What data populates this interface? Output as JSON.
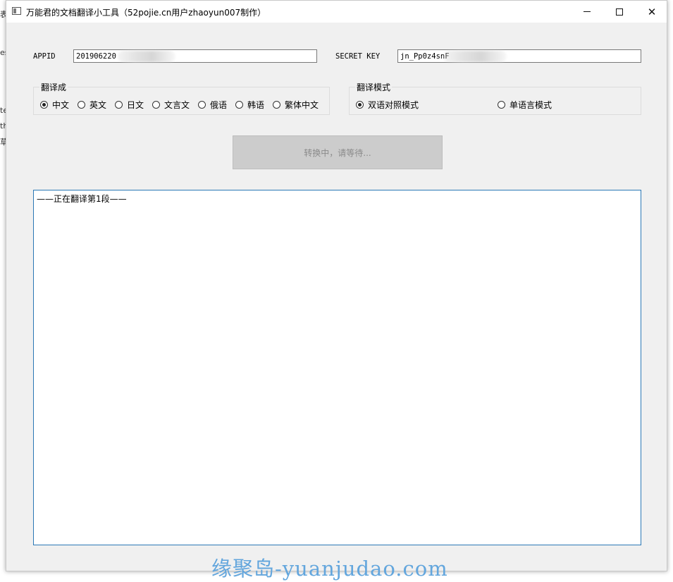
{
  "window": {
    "title": "万能君的文档翻译小工具（52pojie.cn用户zhaoyun007制作）",
    "min_glyph": "",
    "max_glyph": "",
    "close_glyph": "✕"
  },
  "credentials": {
    "appid_label": "APPID",
    "appid_value": "201906220",
    "secret_label": "SECRET KEY",
    "secret_value": "jn_Pp0z4snF"
  },
  "target_lang": {
    "title": "翻译成",
    "options": [
      "中文",
      "英文",
      "日文",
      "文言文",
      "俄语",
      "韩语",
      "繁体中文"
    ],
    "selected": "中文"
  },
  "mode": {
    "title": "翻译模式",
    "options": [
      "双语对照模式",
      "单语言模式"
    ],
    "selected": "双语对照模式"
  },
  "convert_button": {
    "label": "转换中，请等待..."
  },
  "output": {
    "text": "——正在翻译第1段——"
  },
  "watermark": "缘聚岛-yuanjudao.com",
  "background_fragments": [
    "表",
    "es",
    "te",
    "th",
    "草"
  ]
}
